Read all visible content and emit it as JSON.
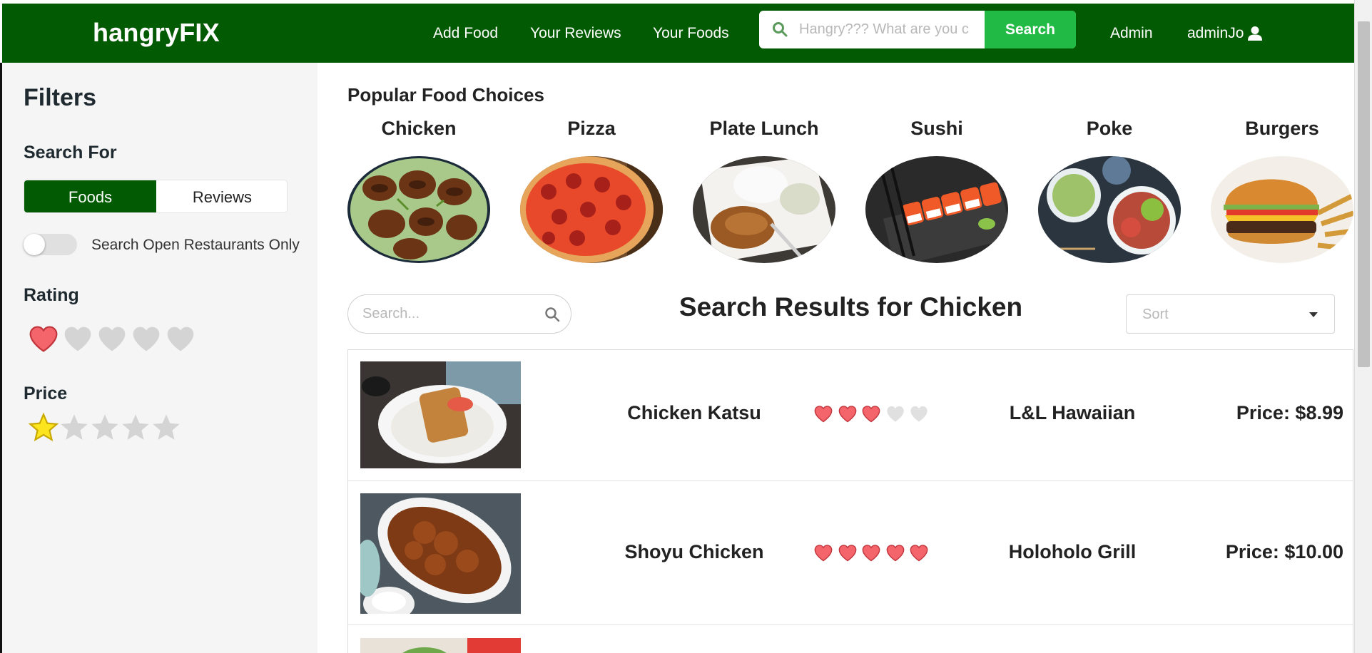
{
  "navbar": {
    "brand": "hangryFIX",
    "links": [
      "Add Food",
      "Your Reviews",
      "Your Foods"
    ],
    "search_placeholder": "Hangry??? What are you c",
    "search_button": "Search",
    "admin_label": "Admin",
    "user_label": "adminJo",
    "colors": {
      "navbar": "#025b02",
      "search_button": "#21ba45"
    }
  },
  "sidebar": {
    "title": "Filters",
    "search_for_heading": "Search For",
    "search_for_options": [
      "Foods",
      "Reviews"
    ],
    "search_for_selected": "Foods",
    "toggle_label": "Search Open Restaurants Only",
    "toggle_on": false,
    "rating_heading": "Rating",
    "rating_selected": 1,
    "rating_max": 5,
    "price_heading": "Price",
    "price_selected": 1,
    "price_max": 5
  },
  "popular": {
    "heading": "Popular Food Choices",
    "categories": [
      "Chicken",
      "Pizza",
      "Plate Lunch",
      "Sushi",
      "Poke",
      "Burgers"
    ]
  },
  "results": {
    "search_placeholder": "Search...",
    "heading": "Search Results for Chicken",
    "sort_placeholder": "Sort",
    "items": [
      {
        "name": "Chicken Katsu",
        "rating": 3,
        "restaurant": "L&L Hawaiian",
        "price": "Price: $8.99"
      },
      {
        "name": "Shoyu Chicken",
        "rating": 5,
        "restaurant": "Holoholo Grill",
        "price": "Price: $10.00"
      }
    ]
  },
  "icons": {
    "search": "search-icon",
    "user": "user-icon",
    "heart": "heart-icon",
    "star": "star-icon",
    "caret": "caret-down-icon"
  },
  "colors": {
    "heart_active": "#f4646b",
    "heart_inactive": "#d4d4d4",
    "star_active": "#fce51e",
    "star_inactive": "#d4d4d4"
  }
}
